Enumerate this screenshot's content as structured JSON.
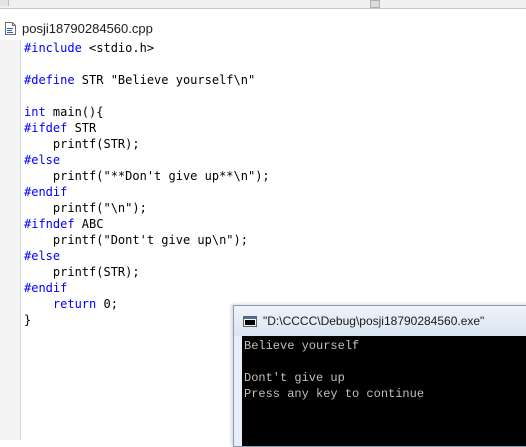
{
  "editor": {
    "tab_title": "posji18790284560.cpp",
    "lines": [
      [
        {
          "t": "#include",
          "k": true
        },
        {
          "t": " <stdio.h>"
        }
      ],
      [],
      [
        {
          "t": "#define",
          "k": true
        },
        {
          "t": " STR \"Believe yourself\\n\""
        }
      ],
      [],
      [
        {
          "t": "int",
          "k": true
        },
        {
          "t": " main(){"
        }
      ],
      [
        {
          "t": "#ifdef",
          "k": true
        },
        {
          "t": " STR"
        }
      ],
      [
        {
          "t": "    printf(STR);"
        }
      ],
      [
        {
          "t": "#else",
          "k": true
        }
      ],
      [
        {
          "t": "    printf(\"**Don't give up**\\n\");"
        }
      ],
      [
        {
          "t": "#endif",
          "k": true
        }
      ],
      [
        {
          "t": "    printf(\"\\n\");"
        }
      ],
      [
        {
          "t": "#ifndef",
          "k": true
        },
        {
          "t": " ABC"
        }
      ],
      [
        {
          "t": "    printf(\"Dont't give up\\n\");"
        }
      ],
      [
        {
          "t": "#else",
          "k": true
        }
      ],
      [
        {
          "t": "    printf(STR);"
        }
      ],
      [
        {
          "t": "#endif",
          "k": true
        }
      ],
      [
        {
          "t": "    "
        },
        {
          "t": "return",
          "k": true
        },
        {
          "t": " 0;"
        }
      ],
      [
        {
          "t": "}"
        }
      ]
    ]
  },
  "console": {
    "title": "\"D:\\CCCC\\Debug\\posji18790284560.exe\"",
    "output_lines": [
      "Believe yourself",
      "",
      "Dont't give up",
      "Press any key to continue"
    ]
  },
  "colors": {
    "keyword": "#0000ff",
    "console_bg": "#000000",
    "console_text": "#c0c0c0"
  },
  "icons": {
    "file": "cpp-file-icon",
    "console": "console-window-icon"
  }
}
